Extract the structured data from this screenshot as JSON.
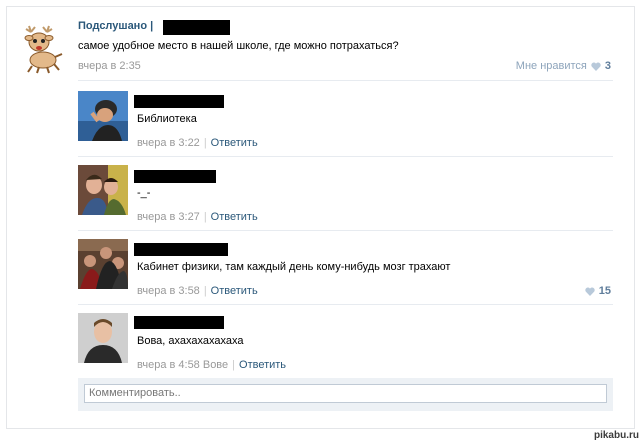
{
  "post": {
    "author": "Подслушано |",
    "text": "самое удобное место в нашей школе, где можно потрахаться?",
    "date": "вчера в 2:35",
    "likes_label": "Мне нравится",
    "likes_count": "3"
  },
  "replies": [
    {
      "text": "Библиотека",
      "date": "вчера в 3:22",
      "reply_label": "Ответить",
      "likes": ""
    },
    {
      "text": "-_-",
      "date": "вчера в 3:27",
      "reply_label": "Ответить",
      "likes": ""
    },
    {
      "text": "Кабинет физики, там каждый день кому-нибудь мозг трахают",
      "date": "вчера в 3:58",
      "reply_label": "Ответить",
      "likes": "15"
    },
    {
      "text": "Вова, ахахахахахаха",
      "date": "вчера в 4:58 Вове",
      "reply_label": "Ответить",
      "likes": ""
    }
  ],
  "comment_box": {
    "placeholder": "Комментировать.."
  },
  "watermark": "pikabu.ru",
  "colors": {
    "link": "#2b587a",
    "muted": "#999999",
    "like": "#5f7d9b"
  }
}
